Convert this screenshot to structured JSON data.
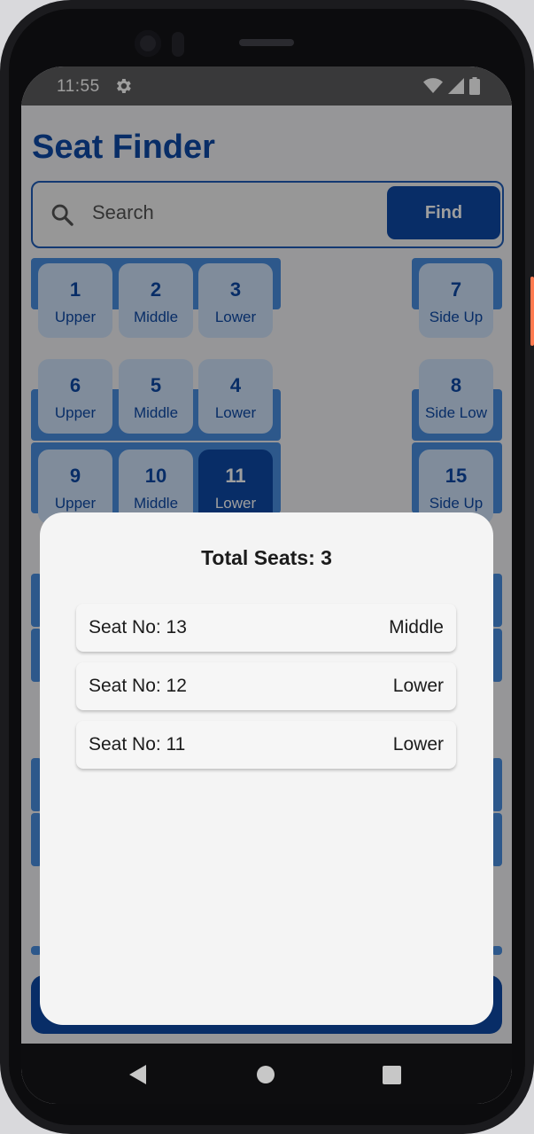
{
  "status": {
    "time": "11:55"
  },
  "app": {
    "title": "Seat Finder"
  },
  "search": {
    "placeholder": "Search",
    "find_label": "Find"
  },
  "seats": [
    {
      "num": "1",
      "type": "Upper"
    },
    {
      "num": "2",
      "type": "Middle"
    },
    {
      "num": "3",
      "type": "Lower"
    },
    {
      "num": "7",
      "type": "Side Up"
    },
    {
      "num": "6",
      "type": "Upper"
    },
    {
      "num": "5",
      "type": "Middle"
    },
    {
      "num": "4",
      "type": "Lower"
    },
    {
      "num": "8",
      "type": "Side Low"
    },
    {
      "num": "9",
      "type": "Upper"
    },
    {
      "num": "10",
      "type": "Middle"
    },
    {
      "num": "11",
      "type": "Lower",
      "selected": true
    },
    {
      "num": "15",
      "type": "Side Up"
    }
  ],
  "sheet": {
    "title": "Total Seats: 3",
    "rows": [
      {
        "seat": "Seat No: 13",
        "type": "Middle"
      },
      {
        "seat": "Seat No: 12",
        "type": "Lower"
      },
      {
        "seat": "Seat No: 11",
        "type": "Lower"
      }
    ]
  },
  "colors": {
    "primary": "#0e4aa6",
    "seat_bg": "#cfe2fa",
    "berth": "#4a8ee0"
  },
  "icons": [
    "gear-icon",
    "search-icon",
    "wifi-icon",
    "signal-icon",
    "battery-icon",
    "back-icon",
    "home-icon",
    "recents-icon"
  ]
}
